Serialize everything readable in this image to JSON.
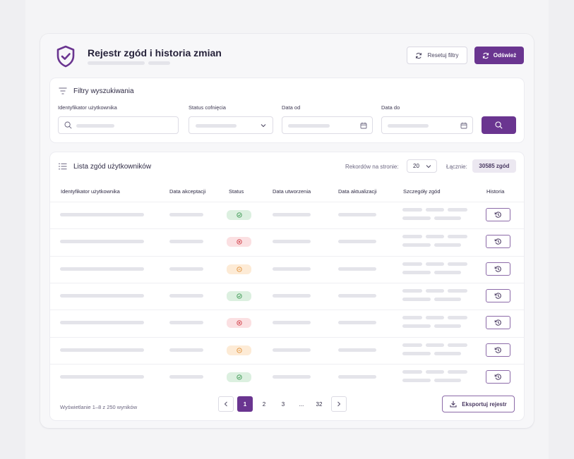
{
  "header": {
    "title": "Rejestr zgód i historia zmian",
    "reset_label": "Resetuj filtry",
    "refresh_label": "Odśwież",
    "shield_icon": "shield-check-icon"
  },
  "filters": {
    "title": "Filtry wyszukiwania",
    "user_id_label": "Identyfikator użytkownika",
    "status_label": "Status cofnięcia",
    "date_from_label": "Data od",
    "date_to_label": "Data do"
  },
  "list": {
    "title": "Lista zgód użytkowników",
    "per_page_label": "Rekordów na stronie:",
    "per_page_value": "20",
    "total_label": "Łącznie:",
    "total_value": "30585 zgód",
    "columns": [
      "Identyfikator użytkownika",
      "Data akceptacji",
      "Status",
      "Data utworzenia",
      "Data aktualizacji",
      "Szczegóły zgód",
      "Historia"
    ],
    "rows": [
      {
        "status": "accepted"
      },
      {
        "status": "revoked"
      },
      {
        "status": "pending"
      },
      {
        "status": "accepted"
      },
      {
        "status": "revoked"
      },
      {
        "status": "pending"
      },
      {
        "status": "accepted"
      }
    ],
    "status_colors": {
      "accepted": {
        "bg": "#dcf0e0",
        "fg": "#3f9a55"
      },
      "revoked": {
        "bg": "#fbe0e2",
        "fg": "#d2404a"
      },
      "pending": {
        "bg": "#fdebd6",
        "fg": "#e0913a"
      }
    }
  },
  "footer": {
    "showing": "Wyświetlanie 1–8 z 250 wyników",
    "pages": [
      "1",
      "2",
      "3",
      "...",
      "32"
    ],
    "current_page": "1",
    "export_label": "Eksportuj rejestr"
  },
  "colors": {
    "accent": "#6a3590"
  }
}
